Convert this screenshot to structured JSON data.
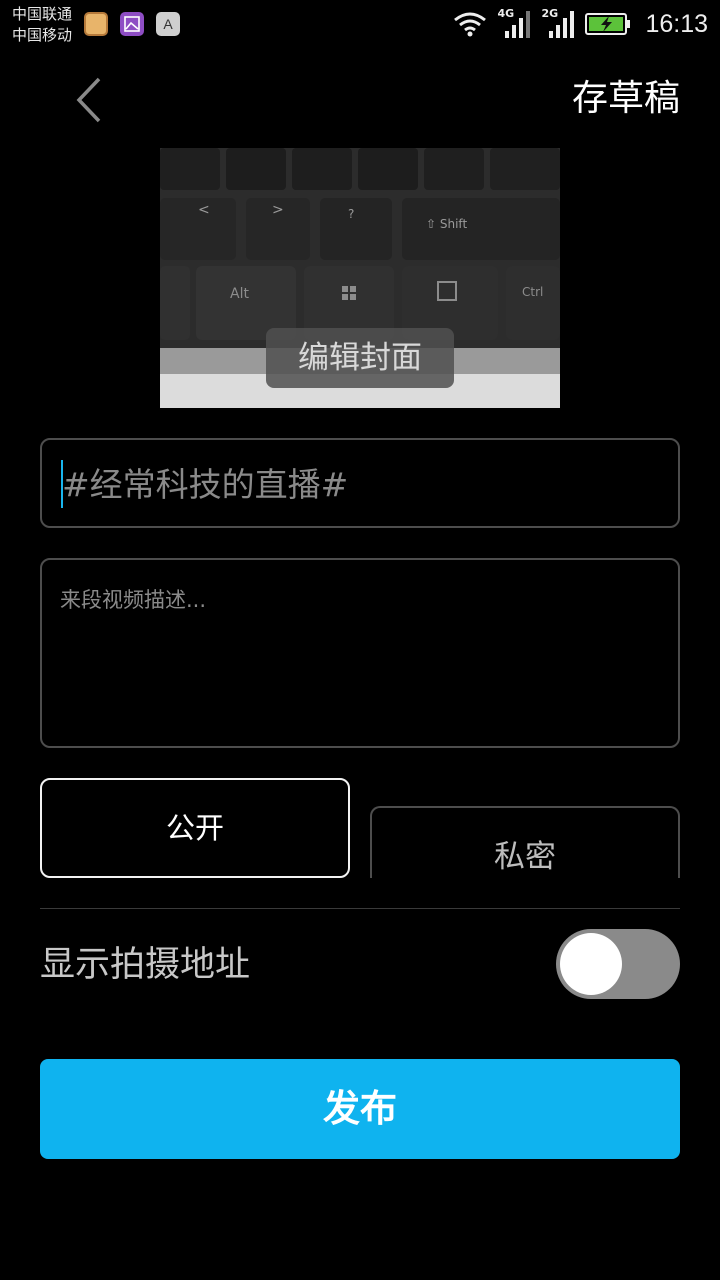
{
  "status_bar": {
    "carrier_1": "中国联通",
    "carrier_2": "中国移动",
    "notification_icons": [
      "game-app-icon",
      "gallery-app-icon",
      "font-app-icon"
    ],
    "font_icon_letter": "A",
    "network_1": "4G",
    "network_2": "2G",
    "time": "16:13"
  },
  "header": {
    "save_draft": "存草稿"
  },
  "cover": {
    "edit_label": "编辑封面"
  },
  "title_input": {
    "value": "#经常科技的直播#"
  },
  "description_input": {
    "placeholder": "来段视频描述..."
  },
  "privacy": {
    "public_label": "公开",
    "private_label": "私密",
    "selected": "公开"
  },
  "location": {
    "label": "显示拍摄地址",
    "enabled": false
  },
  "publish": {
    "label": "发布"
  },
  "colors": {
    "accent": "#0fb3ef",
    "background": "#000000",
    "border": "#4d4d4d"
  }
}
